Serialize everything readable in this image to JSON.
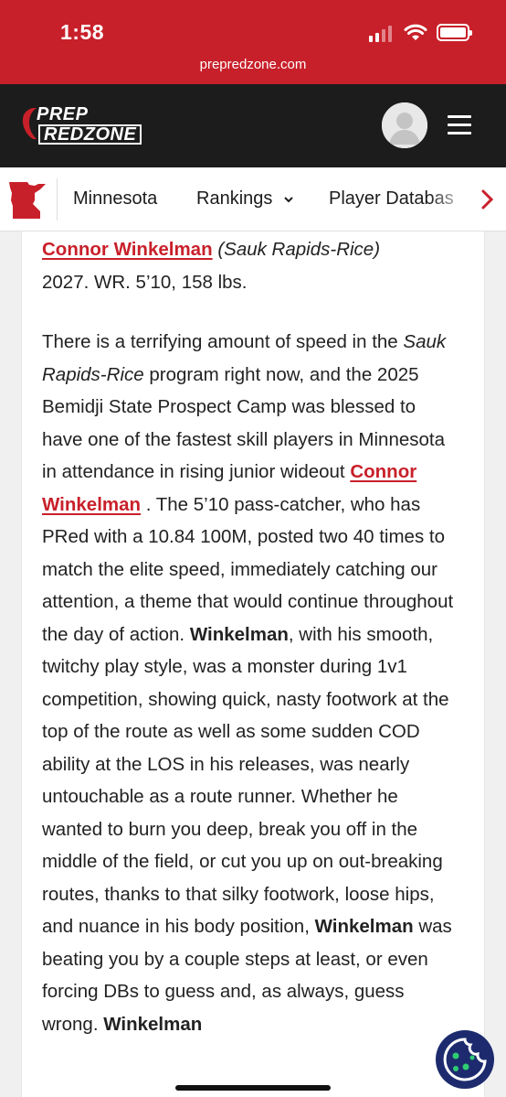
{
  "status_bar": {
    "time": "1:58",
    "url": "prepredzone.com",
    "signal_icon": "cellular-signal-icon",
    "wifi_icon": "wifi-icon",
    "battery_icon": "battery-icon"
  },
  "header": {
    "logo_top": "PREP",
    "logo_bottom": "REDZONE",
    "avatar_icon": "user-avatar-icon",
    "menu_icon": "hamburger-menu-icon",
    "bg_color": "#1c1c1c"
  },
  "nav": {
    "state_icon": "minnesota-state-icon",
    "items": [
      {
        "label": "Minnesota"
      },
      {
        "label": "Rankings"
      },
      {
        "label": "Player Databas"
      }
    ],
    "rankings_chevron": "chevron-down-icon",
    "scroll_icon": "chevron-right-icon"
  },
  "article": {
    "intro": {
      "player_name": "Connor Winkelman",
      "school": "(Sauk Rapids-Rice)",
      "details": "2027. WR. 5’10, 158 lbs."
    },
    "body": {
      "s1": "There is a terrifying amount of speed in the ",
      "school_italic": "Sauk Rapids-Rice",
      "s2": " program right now, and the 2025 Bemidji State Prospect Camp was blessed to have one of the fastest skill players in Minnesota in attendance in rising junior wideout ",
      "player_link": "Connor Winkelman",
      "s3": " . The 5’10 pass-catcher, who has PRed with a 10.84 100M, posted two 40 times to match the elite speed, immediately catching our attention, a theme that would continue throughout the day of action. ",
      "name_bold_1": "Winkelman",
      "s4": ", with his smooth, twitchy play style, was a monster during 1v1 competition, showing quick, nasty footwork at the top of the route as well as some sudden COD ability at the LOS in his releases, was nearly untouchable as a route runner. Whether he wanted to burn you deep, break you off in the middle of the field, or cut you up on out-breaking routes, thanks to that silky footwork, loose hips, and nuance in his body position, ",
      "name_bold_2": "Winkelman",
      "s5": " was beating you by a couple steps at least, or even forcing DBs to guess and, as always, guess wrong. ",
      "name_bold_3": "Winkelman"
    }
  },
  "cookie_button": {
    "icon": "cookie-icon"
  },
  "colors": {
    "brand_red": "#c8202a",
    "link_red": "#c8202a",
    "cookie_bg": "#1d2b6e"
  }
}
